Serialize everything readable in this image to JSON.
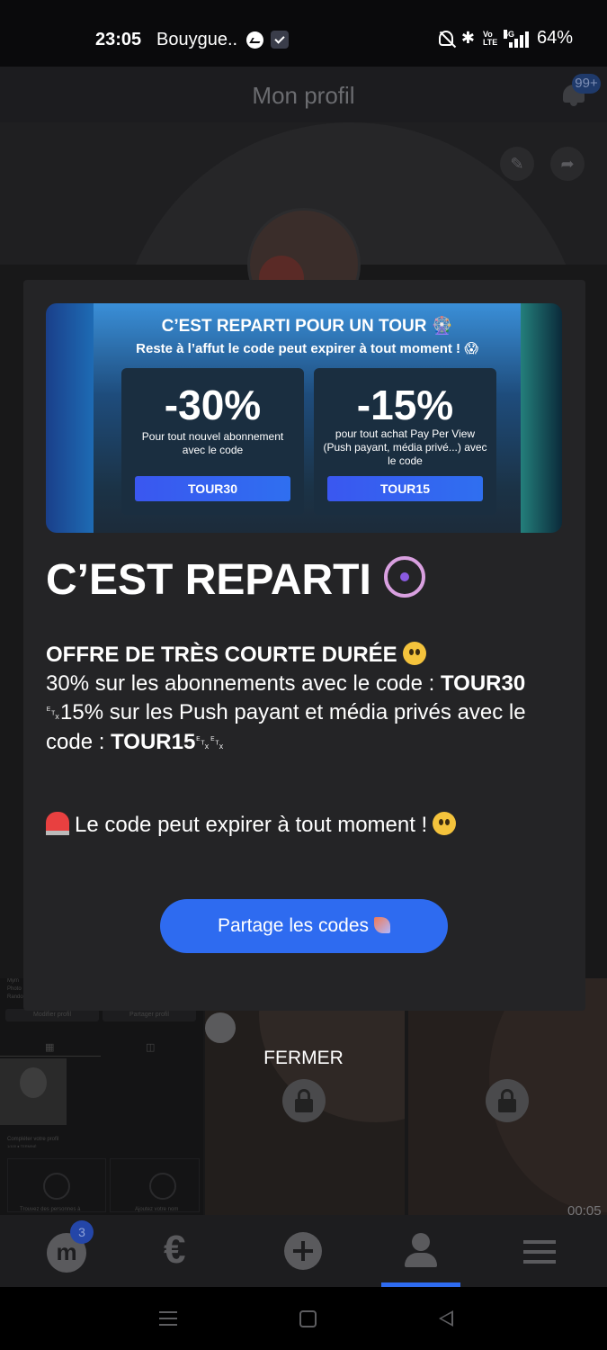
{
  "status_bar": {
    "time": "23:05",
    "carrier": "Bouygue..",
    "network": "4G",
    "volte": "Vo LTE",
    "battery": "64%",
    "icons": [
      "messenger-icon",
      "app-notification-icon",
      "mute-icon",
      "bluetooth-icon",
      "volte-icon",
      "signal-icon"
    ]
  },
  "header": {
    "title": "Mon profil",
    "notification_badge": "99+"
  },
  "banner": {
    "title": "C’EST REPARTI POUR UN TOUR 🎡",
    "subtitle": "Reste à l’affut le code peut expirer à tout moment ! 😱",
    "offers": [
      {
        "percent": "-30%",
        "description": "Pour tout nouvel abonnement avec le code",
        "code": "TOUR30"
      },
      {
        "percent": "-15%",
        "description": "pour tout achat Pay Per View (Push payant, média privé...) avec le code",
        "code": "TOUR15"
      }
    ]
  },
  "modal": {
    "title": "C’EST REPARTI",
    "offer_heading": "OFFRE DE TRÈS COURTE DURÉE",
    "offer_line1_text": "30% sur les abonnements avec le code :",
    "offer_line1_code": "TOUR30",
    "offer_line2_prefix": "␃",
    "offer_line2_text": "15% sur les Push payant et média privés avec le code :",
    "offer_line2_code": "TOUR15",
    "offer_line2_suffix": "␃␃",
    "warning": "Le code peut expirer à tout moment !",
    "share_button": "Partage les codes",
    "close_button": "FERMER"
  },
  "background_profile": {
    "mini_labels": [
      "Mym",
      "Photo",
      "Rando"
    ],
    "mini_edit_profile": "Modifier profil",
    "mini_share_profile": "Partager profil",
    "mini_complete_profile": "Compléter votre profil",
    "mini_complete_sub": "1/100 ● TERMINÉ",
    "mini_find_people": "Trouvez des personnes à",
    "mini_add_name": "Ajoutez votre nom",
    "mini_network": "5G",
    "video_duration": "00:05"
  },
  "bottom_nav": {
    "m_label": "m",
    "m_badge": "3",
    "euro": "€",
    "items": [
      "home",
      "earnings",
      "create",
      "profile",
      "menu"
    ]
  },
  "colors": {
    "accent": "#2e6bf0",
    "modal_bg": "#242426",
    "nav_icon": "#5a5a5d"
  }
}
